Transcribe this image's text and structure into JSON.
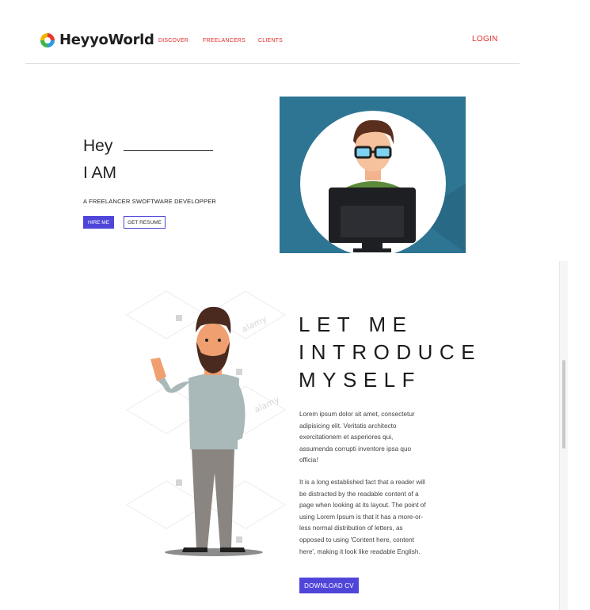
{
  "header": {
    "brand": "HeyyoWorld",
    "nav": [
      "DISCOVER",
      "FREELANCERS",
      "CLIENTS"
    ],
    "login": "LOGIN"
  },
  "hero": {
    "greeting": "Hey",
    "iam": "I AM",
    "subtitle": "A FREELANCER SWOFTWARE DEVELOPPER",
    "hire_label": "HIRE ME",
    "resume_label": "GET RESUME"
  },
  "intro": {
    "title_lines": [
      "LET ME",
      "INTRODUCE",
      "MYSELF"
    ],
    "paragraph1": "Lorem ipsum dolor sit amet, consectetur adipisicing elit. Veritatis architecto exercitationem et asperiores qui, assumenda corrupti inventore ipsa quo officia!",
    "paragraph2": "It is a long established fact that a reader will be distracted by the readable content of a page when looking at its layout. The point of using Lorem Ipsum is that it has a more-or-less normal distribution of letters, as opposed to using 'Content here, content here', making it look like readable English.",
    "download_label": "DOWNLOAD CV",
    "watermark": "alamy"
  },
  "colors": {
    "accent": "#4f46d9",
    "nav": "#e02b2b",
    "hero_bg": "#2e7594"
  },
  "icons": {
    "logo": "colorful-ring-logo-icon"
  }
}
